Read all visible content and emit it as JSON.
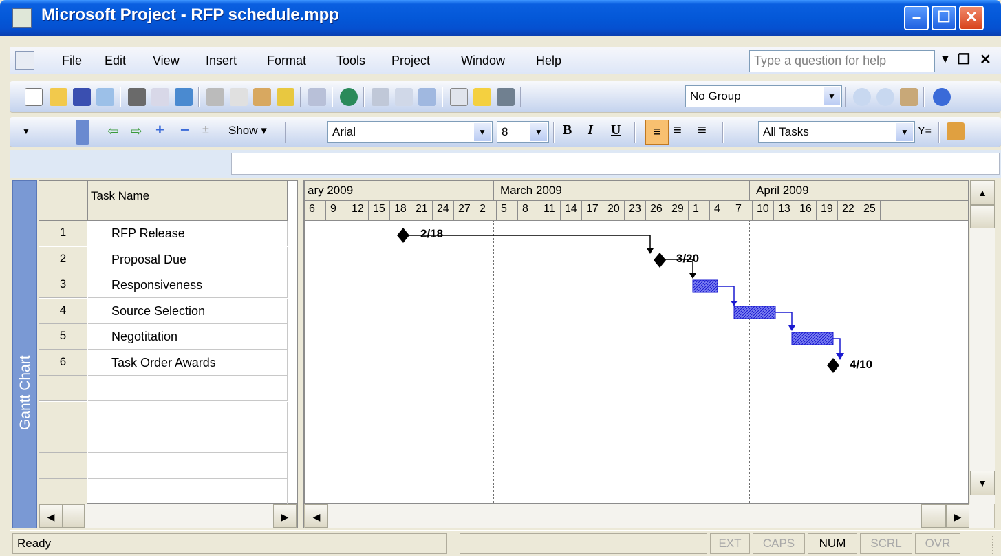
{
  "window": {
    "title": "Microsoft Project - RFP schedule.mpp"
  },
  "menu": {
    "items": [
      "File",
      "Edit",
      "View",
      "Insert",
      "Format",
      "Tools",
      "Project",
      "Window",
      "Help"
    ],
    "help_placeholder": "Type a question for help"
  },
  "toolbar1": {
    "group_value": "No Group"
  },
  "toolbar2": {
    "show_label": "Show",
    "font_value": "Arial",
    "size_value": "8",
    "filter_value": "All Tasks"
  },
  "view_bar": {
    "label": "Gantt Chart"
  },
  "table": {
    "header": "Task Name",
    "rows": [
      {
        "id": "1",
        "name": "RFP Release"
      },
      {
        "id": "2",
        "name": "Proposal Due"
      },
      {
        "id": "3",
        "name": "Responsiveness"
      },
      {
        "id": "4",
        "name": "Source Selection"
      },
      {
        "id": "5",
        "name": "Negotitation"
      },
      {
        "id": "6",
        "name": "Task Order Awards"
      }
    ]
  },
  "timescale": {
    "months": [
      "ary 2009",
      "March 2009",
      "April 2009"
    ],
    "days": [
      "6",
      "9",
      "12",
      "15",
      "18",
      "21",
      "24",
      "27",
      "2",
      "5",
      "8",
      "11",
      "14",
      "17",
      "20",
      "23",
      "26",
      "29",
      "1",
      "4",
      "7",
      "10",
      "13",
      "16",
      "19",
      "22",
      "25"
    ]
  },
  "gantt": {
    "milestone_labels": [
      "2/18",
      "3/20",
      "4/10"
    ],
    "accent": "#2020e0"
  },
  "status": {
    "ready": "Ready",
    "ext": "EXT",
    "caps": "CAPS",
    "num": "NUM",
    "scrl": "SCRL",
    "ovr": "OVR"
  }
}
